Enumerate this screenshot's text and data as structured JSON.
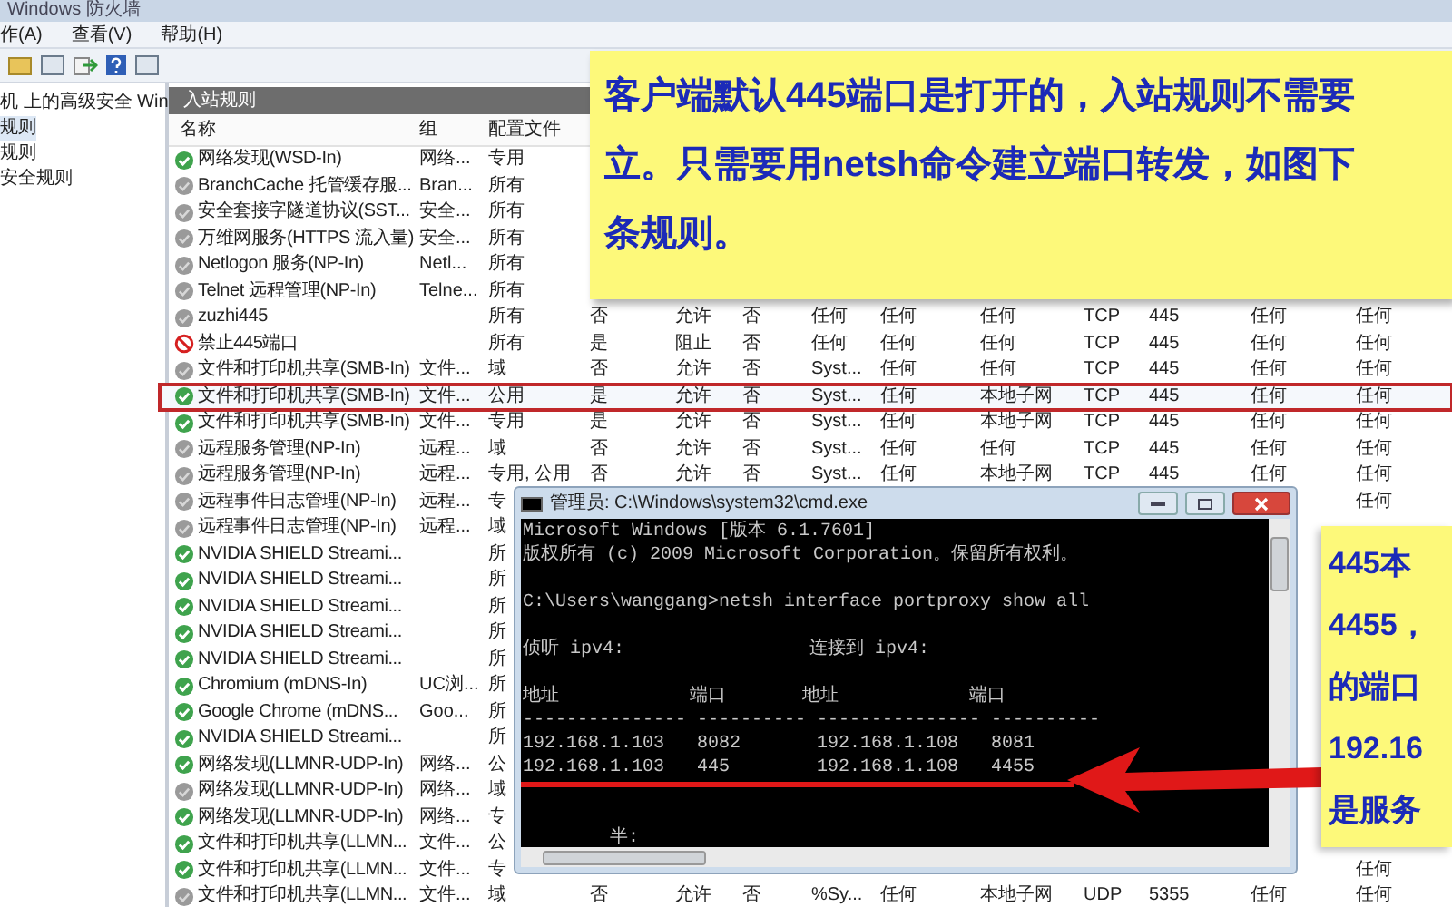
{
  "window": {
    "title": "Windows 防火墙"
  },
  "menu": [
    "作(A)",
    "查看(V)",
    "帮助(H)"
  ],
  "tree": [
    {
      "label": "机 上的高级安全 Win",
      "selected": false
    },
    {
      "label": "规则",
      "selected": true
    },
    {
      "label": "规则",
      "selected": false
    },
    {
      "label": "安全规则",
      "selected": false
    }
  ],
  "table": {
    "title": "入站规则",
    "columns": [
      "名称",
      "组",
      "配置文件"
    ],
    "rows": [
      {
        "kind": "enabled",
        "name": "网络发现(WSD-In)",
        "group": "网络...",
        "profile": "专用",
        "selected": false
      },
      {
        "kind": "disabled",
        "name": "BranchCache 托管缓存服...",
        "group": "Bran...",
        "profile": "所有",
        "selected": false
      },
      {
        "kind": "disabled",
        "name": "安全套接字隧道协议(SST...",
        "group": "安全...",
        "profile": "所有",
        "selected": false
      },
      {
        "kind": "disabled",
        "name": "万维网服务(HTTPS 流入量)",
        "group": "安全...",
        "profile": "所有",
        "selected": false
      },
      {
        "kind": "disabled",
        "name": "Netlogon 服务(NP-In)",
        "group": "Netl...",
        "profile": "所有",
        "selected": false
      },
      {
        "kind": "disabled",
        "name": "Telnet 远程管理(NP-In)",
        "group": "Telne...",
        "profile": "所有",
        "selected": false
      },
      {
        "kind": "disabled",
        "name": "zuzhi445",
        "profile": "所有",
        "selected": false,
        "cells": [
          "否",
          "允许",
          "否",
          "任何",
          "任何",
          "任何",
          "TCP",
          "445",
          "任何",
          "任何"
        ]
      },
      {
        "kind": "blocked",
        "name": "禁止445端口",
        "profile": "所有",
        "selected": false,
        "cells": [
          "是",
          "阻止",
          "否",
          "任何",
          "任何",
          "任何",
          "TCP",
          "445",
          "任何",
          "任何"
        ]
      },
      {
        "kind": "disabled",
        "name": "文件和打印机共享(SMB-In)",
        "group": "文件...",
        "profile": "域",
        "selected": false,
        "cells": [
          "否",
          "允许",
          "否",
          "Syst...",
          "任何",
          "任何",
          "TCP",
          "445",
          "任何",
          "任何"
        ]
      },
      {
        "kind": "enabled",
        "name": "文件和打印机共享(SMB-In)",
        "group": "文件...",
        "profile": "公用",
        "selected": true,
        "cells": [
          "是",
          "允许",
          "否",
          "Syst...",
          "任何",
          "本地子网",
          "TCP",
          "445",
          "任何",
          "任何"
        ]
      },
      {
        "kind": "enabled",
        "name": "文件和打印机共享(SMB-In)",
        "group": "文件...",
        "profile": "专用",
        "selected": false,
        "cells": [
          "是",
          "允许",
          "否",
          "Syst...",
          "任何",
          "本地子网",
          "TCP",
          "445",
          "任何",
          "任何"
        ]
      },
      {
        "kind": "disabled",
        "name": "远程服务管理(NP-In)",
        "group": "远程...",
        "profile": "域",
        "selected": false,
        "cells": [
          "否",
          "允许",
          "否",
          "Syst...",
          "任何",
          "任何",
          "TCP",
          "445",
          "任何",
          "任何"
        ]
      },
      {
        "kind": "disabled",
        "name": "远程服务管理(NP-In)",
        "group": "远程...",
        "profile": "专用, 公用",
        "selected": false,
        "cells": [
          "否",
          "允许",
          "否",
          "Syst...",
          "任何",
          "本地子网",
          "TCP",
          "445",
          "任何",
          "任何"
        ]
      },
      {
        "kind": "disabled",
        "name": "远程事件日志管理(NP-In)",
        "group": "远程...",
        "profile": "专",
        "selected": false,
        "edge_cell": "任何"
      },
      {
        "kind": "disabled",
        "name": "远程事件日志管理(NP-In)",
        "group": "远程...",
        "profile": "域",
        "selected": false
      },
      {
        "kind": "enabled",
        "name": "NVIDIA SHIELD Streami...",
        "profile": "所",
        "selected": false
      },
      {
        "kind": "enabled",
        "name": "NVIDIA SHIELD Streami...",
        "profile": "所",
        "selected": false
      },
      {
        "kind": "enabled",
        "name": "NVIDIA SHIELD Streami...",
        "profile": "所",
        "selected": false
      },
      {
        "kind": "enabled",
        "name": "NVIDIA SHIELD Streami...",
        "profile": "所",
        "selected": false
      },
      {
        "kind": "enabled",
        "name": "NVIDIA SHIELD Streami...",
        "profile": "所",
        "selected": false
      },
      {
        "kind": "enabled",
        "name": "Chromium (mDNS-In)",
        "group": "UC浏...",
        "profile": "所",
        "selected": false
      },
      {
        "kind": "enabled",
        "name": "Google Chrome (mDNS...",
        "group": "Goo...",
        "profile": "所",
        "selected": false
      },
      {
        "kind": "enabled",
        "name": "NVIDIA SHIELD Streami...",
        "profile": "所",
        "selected": false
      },
      {
        "kind": "enabled",
        "name": "网络发现(LLMNR-UDP-In)",
        "group": "网络...",
        "profile": "公",
        "selected": false
      },
      {
        "kind": "disabled",
        "name": "网络发现(LLMNR-UDP-In)",
        "group": "网络...",
        "profile": "域",
        "selected": false
      },
      {
        "kind": "enabled",
        "name": "网络发现(LLMNR-UDP-In)",
        "group": "网络...",
        "profile": "专",
        "selected": false
      },
      {
        "kind": "enabled",
        "name": "文件和打印机共享(LLMN...",
        "group": "文件...",
        "profile": "公",
        "selected": false
      },
      {
        "kind": "enabled",
        "name": "文件和打印机共享(LLMN...",
        "group": "文件...",
        "profile": "专",
        "selected": false,
        "edge_cell": "任何"
      },
      {
        "kind": "disabled",
        "name": "文件和打印机共享(LLMN...",
        "group": "文件...",
        "profile": "域",
        "selected": false,
        "cells": [
          "否",
          "允许",
          "否",
          "%Sy...",
          "任何",
          "本地子网",
          "UDP",
          "5355",
          "任何",
          "任何"
        ]
      }
    ]
  },
  "note_top": {
    "lines": [
      "客户端默认445端口是打开的，入站规则不需要",
      "立。只需要用netsh命令建立端口转发，如图下",
      "条规则。"
    ]
  },
  "cmd": {
    "title": "管理员: C:\\Windows\\system32\\cmd.exe",
    "blocks": [
      [
        "Microsoft Windows [版本 6.1.7601]",
        "版权所有 (c) 2009 Microsoft Corporation。保留所有权利。"
      ],
      [
        "C:\\Users\\wanggang>netsh interface portproxy show all"
      ],
      [
        "侦听 ipv4:                 连接到 ipv4:"
      ],
      [
        "地址            端口       地址            端口",
        "--------------- ---------- --------------- ----------",
        "192.168.1.103   8082       192.168.1.108   8081",
        "192.168.1.103   445        192.168.1.108   4455"
      ],
      [
        "        半:"
      ]
    ]
  },
  "note_right": {
    "lines": [
      "445本",
      "4455，",
      "的端口",
      "192.16",
      "是服务"
    ]
  }
}
